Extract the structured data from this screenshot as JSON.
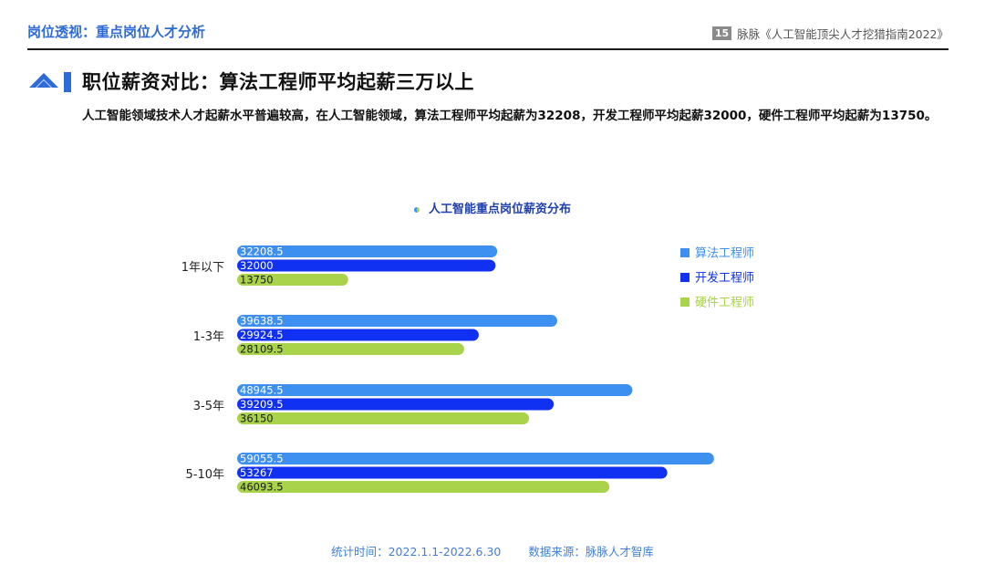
{
  "header": {
    "section_title": "岗位透视：重点岗位人才分析",
    "page_number": "15",
    "report_ref": "脉脉《人工智能顶尖人才挖猎指南2022》"
  },
  "heading": "职位薪资对比：算法工程师平均起薪三万以上",
  "summary": "人工智能领域技术人才起薪水平普遍较高，在人工智能领域，算法工程师平均起薪为32208，开发工程师平均起薪32000，硬件工程师平均起薪为13750。",
  "colors": {
    "accent": "#2f6bd6",
    "series": [
      "#3d8ff0",
      "#1131f2",
      "#a8d34a"
    ]
  },
  "chart_data": {
    "type": "bar",
    "orientation": "horizontal",
    "title": "人工智能重点岗位薪资分布",
    "categories": [
      "1年以下",
      "1-3年",
      "3-5年",
      "5-10年"
    ],
    "series": [
      {
        "name": "算法工程师",
        "values": [
          32208.5,
          39638.5,
          48945.5,
          59055.5
        ],
        "labels": [
          "32208.5",
          "39638.5",
          "48945.5",
          "59055.5"
        ]
      },
      {
        "name": "开发工程师",
        "values": [
          32000,
          29924.5,
          39209.5,
          53267
        ],
        "labels": [
          "32000",
          "29924.5",
          "39209.5",
          "53267"
        ]
      },
      {
        "name": "硬件工程师",
        "values": [
          13750,
          28109.5,
          36150,
          46093.5
        ],
        "labels": [
          "13750",
          "28109.5",
          "36150",
          "46093.5"
        ]
      }
    ],
    "legend_position": "right",
    "grid": false,
    "xlim": [
      0,
      60000
    ]
  },
  "footer": {
    "period": "统计时间：2022.1.1-2022.6.30",
    "source": "数据来源：脉脉人才智库"
  }
}
